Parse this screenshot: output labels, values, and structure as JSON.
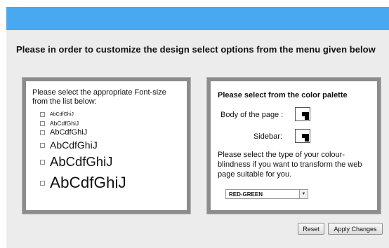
{
  "heading": "Please in order to customize the design select options from the menu given below",
  "font_panel": {
    "intro": "Please select the appropriate Font-size from the list below:",
    "options": [
      "AbCdfGhiJ",
      "AbCdfGhiJ",
      "AbCdfGhiJ",
      "AbCdfGhiJ",
      "AbCdfGhiJ",
      "AbCdfGhiJ"
    ],
    "checked": [
      false,
      false,
      false,
      false,
      false,
      false
    ]
  },
  "color_panel": {
    "title": "Please select from the color palette",
    "body_label": "Body of the page :",
    "sidebar_label": "Sidebar:",
    "colorblind_text": "Please select the type of your colour-blindness if you want to transform the web page suitable for you.",
    "colorblind_selected": "RED-GREEN"
  },
  "buttons": {
    "reset": "Reset",
    "apply": "Apply Changes"
  },
  "colors": {
    "topbar": "#48a9f0",
    "background": "#ececec",
    "panel_border": "#8c8c8c"
  },
  "icons": {
    "dropdown": "chevron-down-icon",
    "swatch": "color-swatch-icon"
  }
}
